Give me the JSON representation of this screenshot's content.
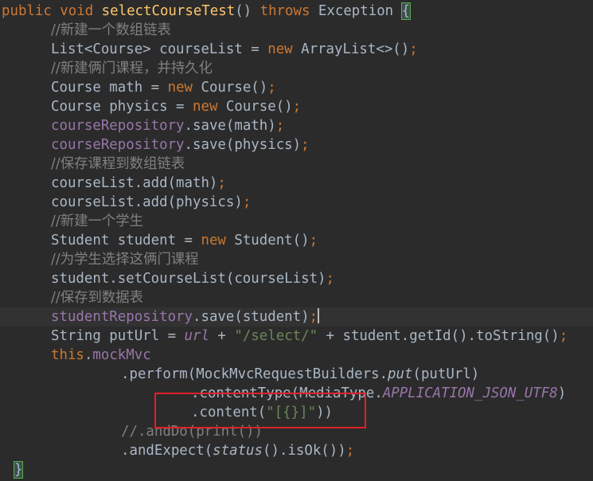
{
  "editor": {
    "lines": [
      {
        "indent": 2,
        "tokens": [
          {
            "t": "public ",
            "c": "kw"
          },
          {
            "t": "void ",
            "c": "kw"
          },
          {
            "t": "selectCourseTest",
            "c": "fn"
          },
          {
            "t": "() ",
            "c": "id"
          },
          {
            "t": "throws ",
            "c": "kw"
          },
          {
            "t": "Exception ",
            "c": "id"
          },
          {
            "t": "{",
            "c": "brace-match"
          }
        ]
      },
      {
        "indent": 64,
        "tokens": [
          {
            "t": "//新建一个数组链表",
            "c": "cmt cjk"
          }
        ]
      },
      {
        "indent": 64,
        "tokens": [
          {
            "t": "List<Course> courseList = ",
            "c": "id"
          },
          {
            "t": "new ",
            "c": "kw"
          },
          {
            "t": "ArrayList<>()",
            "c": "id"
          },
          {
            "t": ";",
            "c": "kw"
          }
        ]
      },
      {
        "indent": 64,
        "tokens": [
          {
            "t": "//新建俩门课程，并持久化",
            "c": "cmt cjk"
          }
        ]
      },
      {
        "indent": 64,
        "tokens": [
          {
            "t": "Course math = ",
            "c": "id"
          },
          {
            "t": "new ",
            "c": "kw"
          },
          {
            "t": "Course()",
            "c": "id"
          },
          {
            "t": ";",
            "c": "kw"
          }
        ]
      },
      {
        "indent": 64,
        "tokens": [
          {
            "t": "Course physics = ",
            "c": "id"
          },
          {
            "t": "new ",
            "c": "kw"
          },
          {
            "t": "Course()",
            "c": "id"
          },
          {
            "t": ";",
            "c": "kw"
          }
        ]
      },
      {
        "indent": 64,
        "tokens": [
          {
            "t": "courseRepository",
            "c": "field"
          },
          {
            "t": ".save(math)",
            "c": "id"
          },
          {
            "t": ";",
            "c": "kw"
          }
        ]
      },
      {
        "indent": 64,
        "tokens": [
          {
            "t": "courseRepository",
            "c": "field"
          },
          {
            "t": ".save(physics)",
            "c": "id"
          },
          {
            "t": ";",
            "c": "kw"
          }
        ]
      },
      {
        "indent": 64,
        "tokens": [
          {
            "t": "//保存课程到数组链表",
            "c": "cmt cjk"
          }
        ]
      },
      {
        "indent": 64,
        "tokens": [
          {
            "t": "courseList.add(math)",
            "c": "id"
          },
          {
            "t": ";",
            "c": "kw"
          }
        ]
      },
      {
        "indent": 64,
        "tokens": [
          {
            "t": "courseList.add(physics)",
            "c": "id"
          },
          {
            "t": ";",
            "c": "kw"
          }
        ]
      },
      {
        "indent": 64,
        "tokens": [
          {
            "t": "//新建一个学生",
            "c": "cmt cjk"
          }
        ]
      },
      {
        "indent": 64,
        "tokens": [
          {
            "t": "Student student = ",
            "c": "id"
          },
          {
            "t": "new ",
            "c": "kw"
          },
          {
            "t": "Student()",
            "c": "id"
          },
          {
            "t": ";",
            "c": "kw"
          }
        ]
      },
      {
        "indent": 64,
        "tokens": [
          {
            "t": "//为学生选择这俩门课程",
            "c": "cmt cjk"
          }
        ]
      },
      {
        "indent": 64,
        "tokens": [
          {
            "t": "student.setCourseList(courseList)",
            "c": "id"
          },
          {
            "t": ";",
            "c": "kw"
          }
        ]
      },
      {
        "indent": 64,
        "tokens": [
          {
            "t": "//保存到数据表",
            "c": "cmt cjk"
          }
        ]
      },
      {
        "indent": 64,
        "current": true,
        "caret_after": true,
        "tokens": [
          {
            "t": "studentRepository",
            "c": "field"
          },
          {
            "t": ".save(student)",
            "c": "id"
          },
          {
            "t": ";",
            "c": "kw"
          }
        ]
      },
      {
        "indent": 64,
        "tokens": [
          {
            "t": "String putUrl = ",
            "c": "id"
          },
          {
            "t": "url",
            "c": "static"
          },
          {
            "t": " + ",
            "c": "id"
          },
          {
            "t": "\"/select/\"",
            "c": "str"
          },
          {
            "t": " + student.getId().toString()",
            "c": "id"
          },
          {
            "t": ";",
            "c": "kw"
          }
        ]
      },
      {
        "indent": 64,
        "tokens": [
          {
            "t": "this",
            "c": "kw"
          },
          {
            "t": ".",
            "c": "id"
          },
          {
            "t": "mockMvc",
            "c": "field"
          }
        ]
      },
      {
        "indent": 152,
        "tokens": [
          {
            "t": ".perform(MockMvcRequestBuilders.",
            "c": "id"
          },
          {
            "t": "put",
            "c": "italic"
          },
          {
            "t": "(putUrl)",
            "c": "id"
          }
        ]
      },
      {
        "indent": 240,
        "tokens": [
          {
            "t": ".contentType(MediaType.",
            "c": "id"
          },
          {
            "t": "APPLICATION_JSON_UTF8",
            "c": "static"
          },
          {
            "t": ")",
            "c": "id"
          }
        ]
      },
      {
        "indent": 240,
        "tokens": [
          {
            "t": ".content(",
            "c": "id"
          },
          {
            "t": "\"[{}]\"",
            "c": "str"
          },
          {
            "t": "))",
            "c": "id"
          }
        ]
      },
      {
        "indent": 152,
        "tokens": [
          {
            "t": "//.andDo(print())",
            "c": "cmt"
          }
        ]
      },
      {
        "indent": 152,
        "tokens": [
          {
            "t": ".andExpect(",
            "c": "id"
          },
          {
            "t": "status",
            "c": "italic"
          },
          {
            "t": "().isOk())",
            "c": "id"
          },
          {
            "t": ";",
            "c": "kw"
          }
        ]
      },
      {
        "indent": 18,
        "tokens": [
          {
            "t": "}",
            "c": "brace-match"
          }
        ]
      }
    ]
  },
  "colors": {
    "background": "#2b2b2b",
    "current_line": "#323232",
    "keyword": "#cc7832",
    "identifier": "#a9b7c6",
    "method_declaration": "#ffc66d",
    "field": "#9876aa",
    "string": "#6a8759",
    "comment": "#808080",
    "annotation_box": "#e0202c"
  }
}
